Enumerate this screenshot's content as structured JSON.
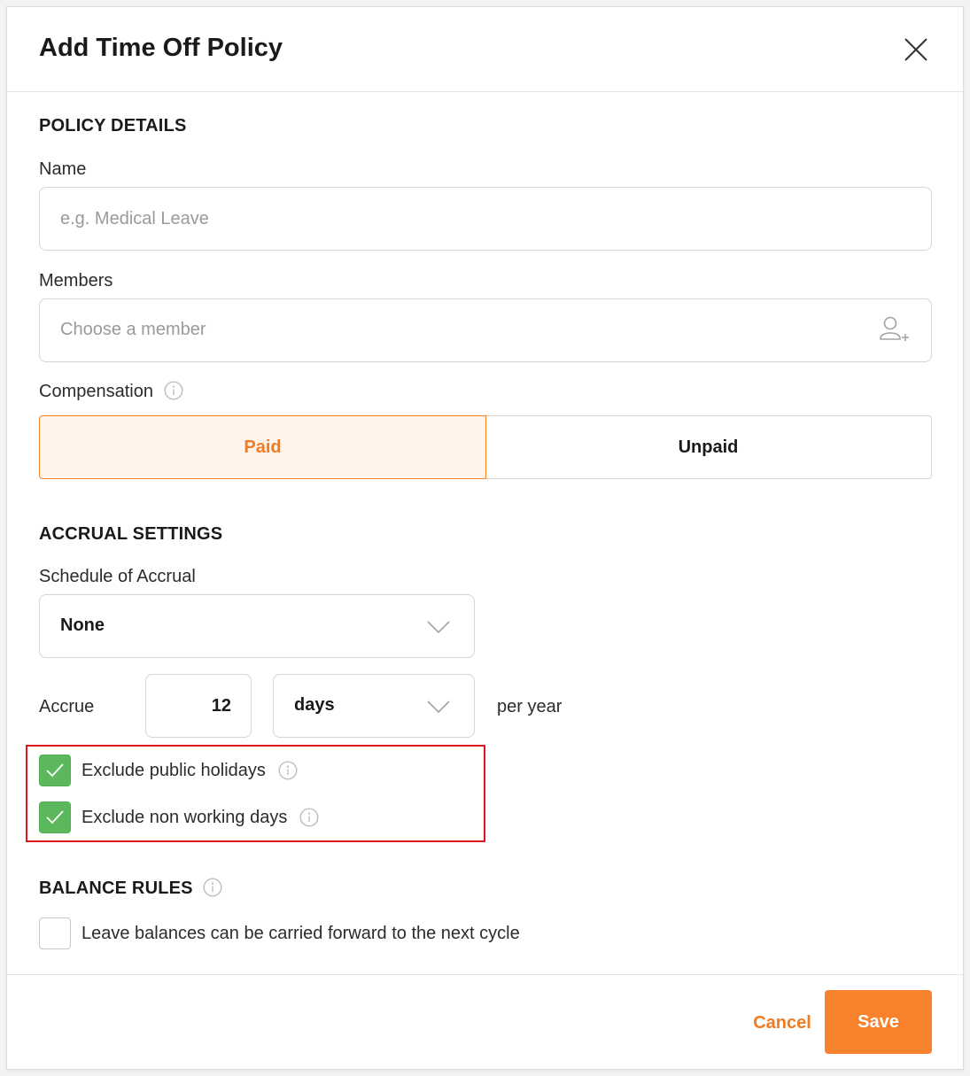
{
  "dialog": {
    "title": "Add Time Off Policy"
  },
  "policy_details": {
    "heading": "POLICY DETAILS",
    "name_label": "Name",
    "name_placeholder": "e.g. Medical Leave",
    "members_label": "Members",
    "members_placeholder": "Choose a member",
    "compensation_label": "Compensation",
    "compensation_options": [
      "Paid",
      "Unpaid"
    ],
    "compensation_selected": "Paid"
  },
  "accrual_settings": {
    "heading": "ACCRUAL SETTINGS",
    "schedule_label": "Schedule of Accrual",
    "schedule_value": "None",
    "accrue_label": "Accrue",
    "accrue_amount": "12",
    "accrue_unit": "days",
    "per_label": "per year",
    "exclude_public_holidays": {
      "label": "Exclude public holidays",
      "checked": true
    },
    "exclude_non_working_days": {
      "label": "Exclude non working days",
      "checked": true
    }
  },
  "balance_rules": {
    "heading": "BALANCE RULES",
    "carry_forward": {
      "label": "Leave balances can be carried forward to the next cycle",
      "checked": false
    }
  },
  "footer": {
    "cancel_label": "Cancel",
    "save_label": "Save"
  },
  "colors": {
    "accent": "#f7822b",
    "accent_light": "#fff3ea",
    "check_green": "#5cb85c",
    "highlight_red": "#e0161f"
  }
}
